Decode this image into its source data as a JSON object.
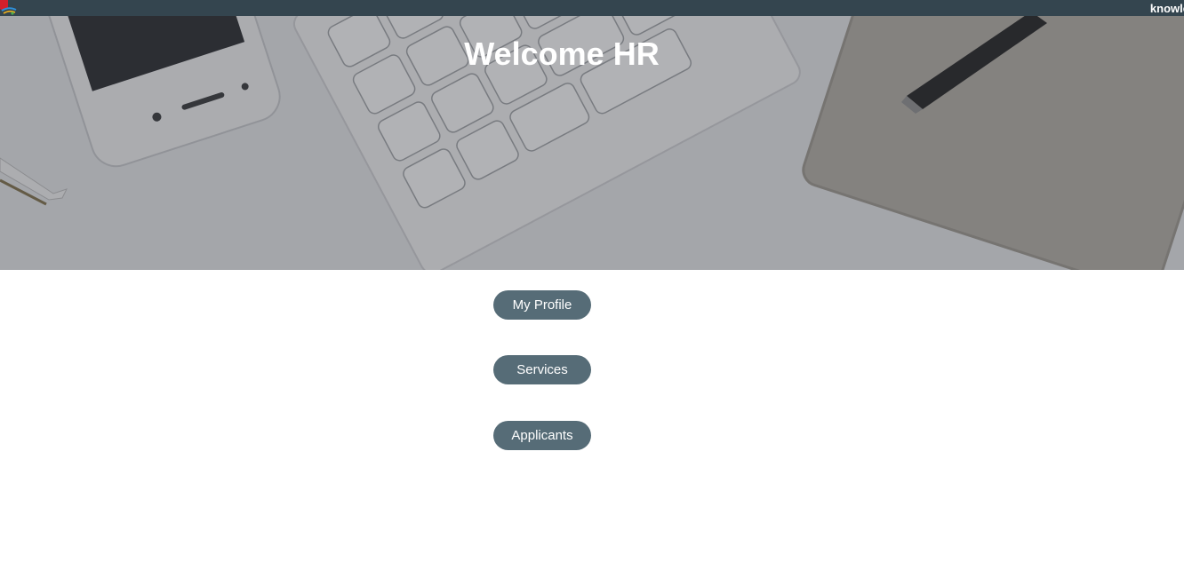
{
  "topbar": {
    "brand_text": "knowle",
    "logo_icon": "company-logo",
    "background": "#34454f"
  },
  "hero": {
    "title": "Welcome HR",
    "background_image": "desk-with-phone-keyboard-notebook-pen"
  },
  "menu": {
    "button_color": "#566c77",
    "items": [
      {
        "label": "My Profile"
      },
      {
        "label": "Services"
      },
      {
        "label": "Applicants"
      }
    ]
  }
}
